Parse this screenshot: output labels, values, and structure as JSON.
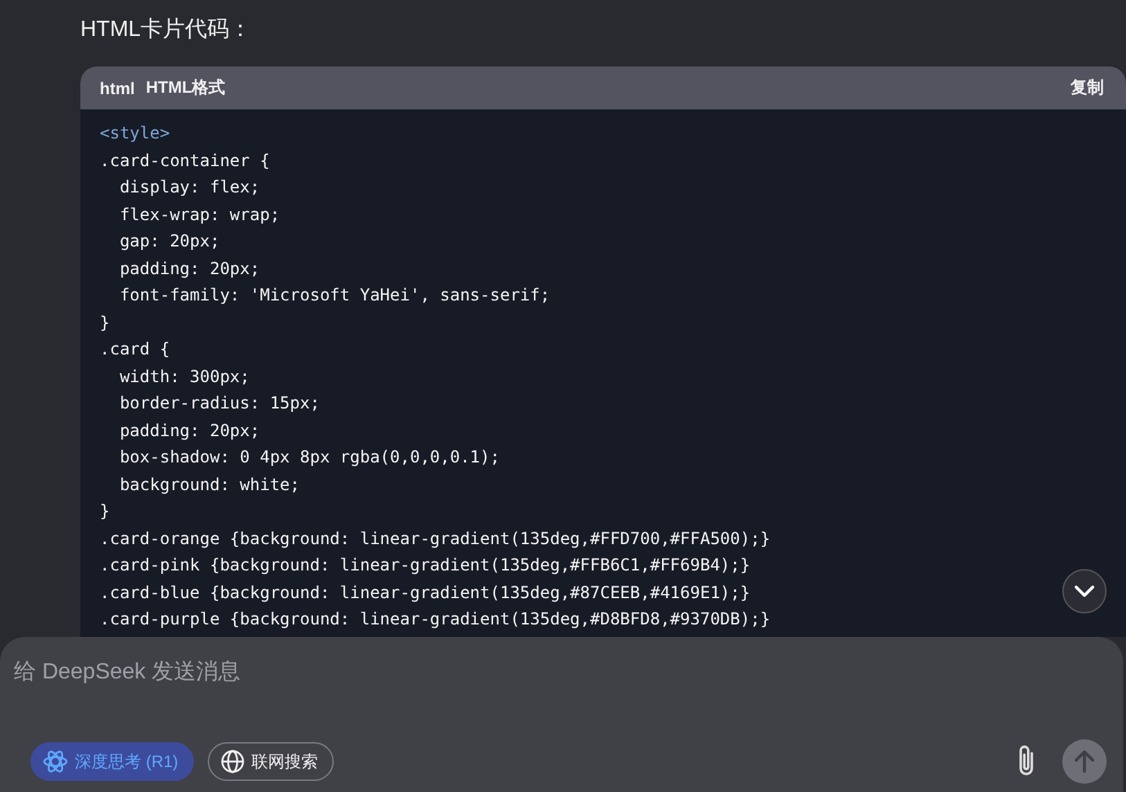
{
  "heading": "HTML卡片代码：",
  "code_block": {
    "language": "html",
    "title": "HTML格式",
    "copy_label": "复制",
    "lines": [
      {
        "kind": "tag",
        "text": "<style>"
      },
      {
        "kind": "code",
        "text": ".card-container {"
      },
      {
        "kind": "code",
        "text": "  display: flex;"
      },
      {
        "kind": "code",
        "text": "  flex-wrap: wrap;"
      },
      {
        "kind": "code",
        "text": "  gap: 20px;"
      },
      {
        "kind": "code",
        "text": "  padding: 20px;"
      },
      {
        "kind": "code",
        "text": "  font-family: 'Microsoft YaHei', sans-serif;"
      },
      {
        "kind": "code",
        "text": "}"
      },
      {
        "kind": "code",
        "text": ".card {"
      },
      {
        "kind": "code",
        "text": "  width: 300px;"
      },
      {
        "kind": "code",
        "text": "  border-radius: 15px;"
      },
      {
        "kind": "code",
        "text": "  padding: 20px;"
      },
      {
        "kind": "code",
        "text": "  box-shadow: 0 4px 8px rgba(0,0,0,0.1);"
      },
      {
        "kind": "code",
        "text": "  background: white;"
      },
      {
        "kind": "code",
        "text": "}"
      },
      {
        "kind": "code",
        "text": ".card-orange {background: linear-gradient(135deg,#FFD700,#FFA500);}"
      },
      {
        "kind": "code",
        "text": ".card-pink {background: linear-gradient(135deg,#FFB6C1,#FF69B4);}"
      },
      {
        "kind": "code",
        "text": ".card-blue {background: linear-gradient(135deg,#87CEEB,#4169E1);}"
      },
      {
        "kind": "code",
        "text": ".card-purple {background: linear-gradient(135deg,#D8BFD8,#9370DB);}"
      }
    ]
  },
  "composer": {
    "placeholder": "给 DeepSeek 发送消息",
    "toggles": [
      {
        "kind": "think",
        "label": "深度思考 (R1)",
        "selected": true
      },
      {
        "kind": "search",
        "label": "联网搜索",
        "selected": false
      }
    ]
  }
}
